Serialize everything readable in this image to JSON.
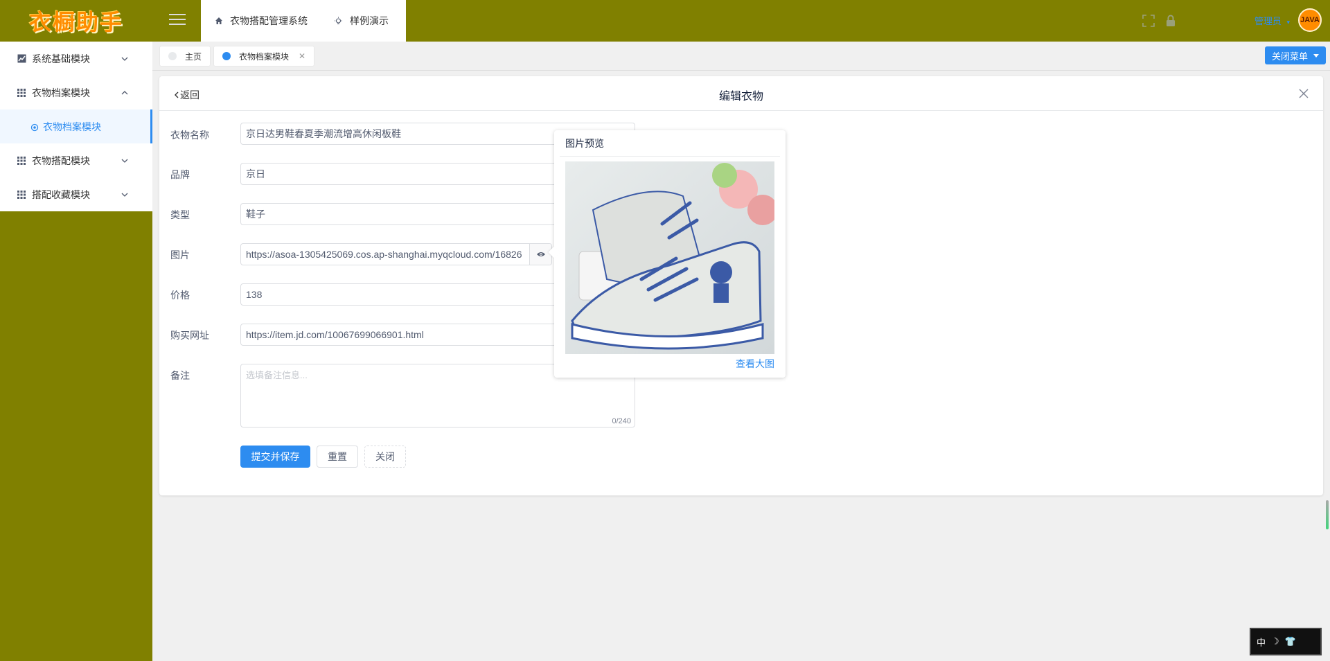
{
  "app": {
    "logo_text": "衣橱助手"
  },
  "sidebar": {
    "items": [
      {
        "label": "系统基础模块",
        "icon": "chart-icon",
        "expanded": false
      },
      {
        "label": "衣物档案模块",
        "icon": "grid-icon",
        "expanded": true
      },
      {
        "label": "衣物搭配模块",
        "icon": "grid-icon",
        "expanded": false
      },
      {
        "label": "搭配收藏模块",
        "icon": "grid-icon",
        "expanded": false
      }
    ],
    "active_sub": "衣物档案模块"
  },
  "header": {
    "tabs": [
      {
        "label": "衣物搭配管理系统",
        "icon": "home-icon"
      },
      {
        "label": "样例演示",
        "icon": "bulb-icon"
      }
    ],
    "user": "管理员",
    "avatar_text": "JAVA"
  },
  "tagbar": {
    "tags": [
      {
        "label": "主页",
        "active": false
      },
      {
        "label": "衣物档案模块",
        "active": true
      }
    ],
    "close_menu_label": "关闭菜单"
  },
  "form": {
    "back_label": "返回",
    "title": "编辑衣物",
    "fields": {
      "name": {
        "label": "衣物名称",
        "value": "京日达男鞋春夏季潮流增高休闲板鞋"
      },
      "brand": {
        "label": "品牌",
        "value": "京日"
      },
      "type": {
        "label": "类型",
        "value": "鞋子"
      },
      "image": {
        "label": "图片",
        "value": "https://asoa-1305425069.cos.ap-shanghai.myqcloud.com/16826"
      },
      "price": {
        "label": "价格",
        "value": "138"
      },
      "url": {
        "label": "购买网址",
        "value": "https://item.jd.com/10067699066901.html"
      },
      "remark": {
        "label": "备注",
        "placeholder": "选填备注信息...",
        "counter": "0/240"
      }
    },
    "buttons": {
      "submit": "提交并保存",
      "reset": "重置",
      "close": "关闭"
    }
  },
  "preview": {
    "title": "图片预览",
    "link": "查看大图"
  },
  "ime": {
    "label": "中"
  },
  "colors": {
    "olive": "#808000",
    "accent": "#2d8cf0",
    "logo": "#ff8c00"
  }
}
